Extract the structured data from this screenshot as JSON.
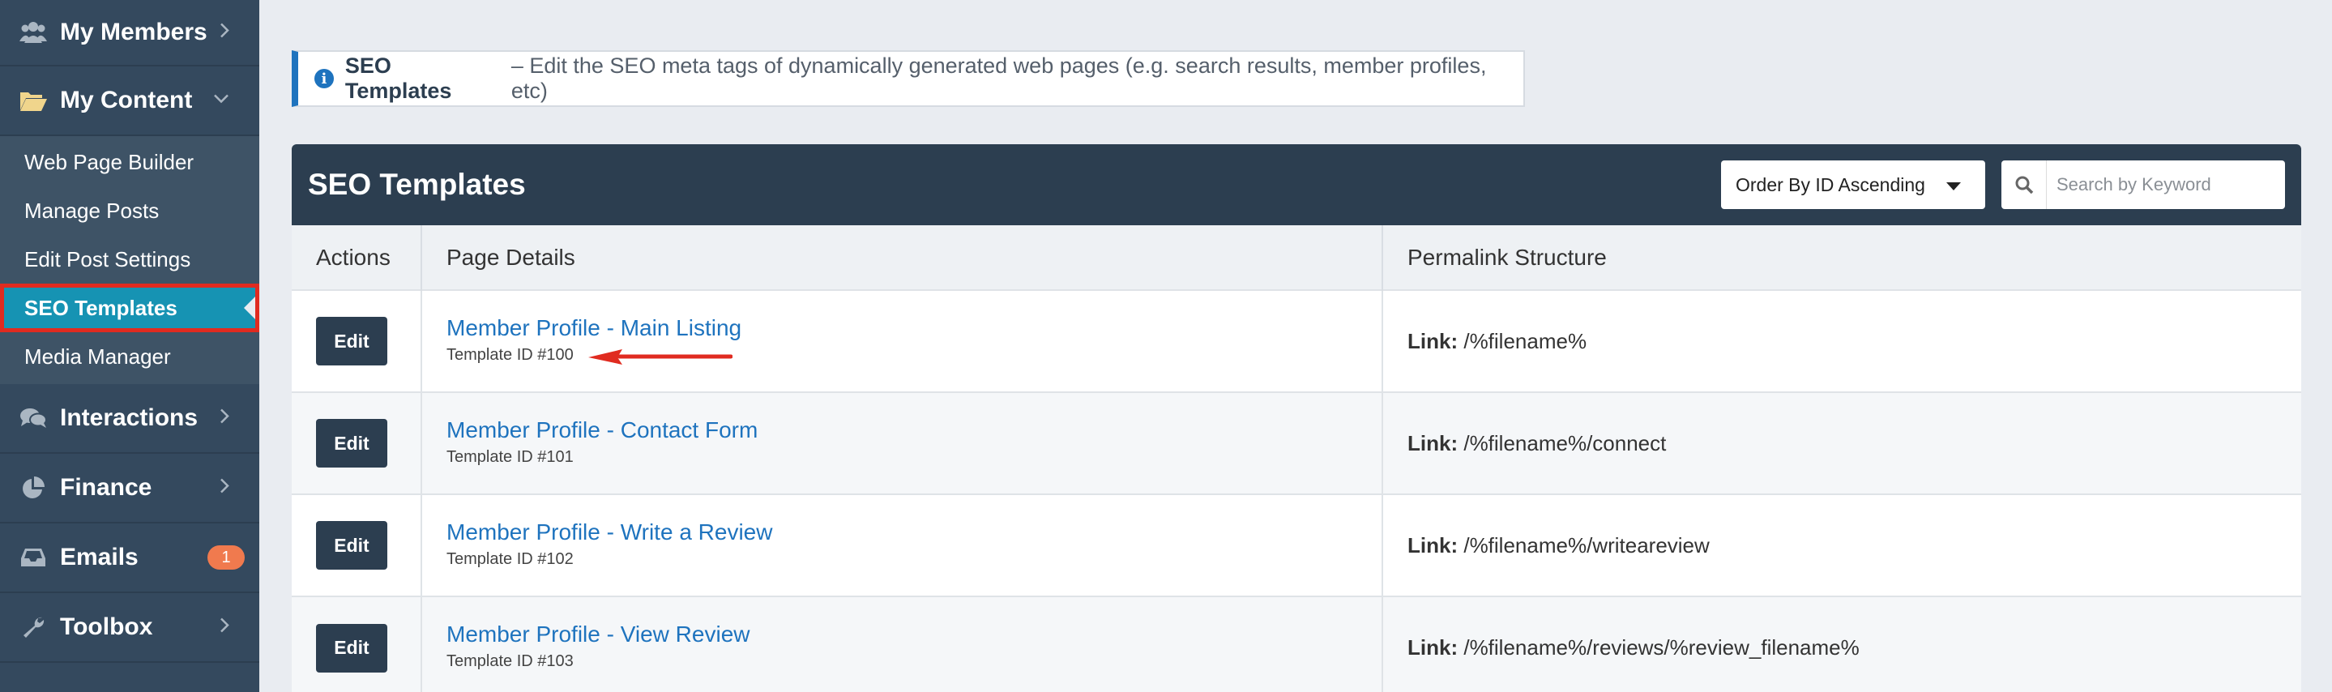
{
  "sidebar": {
    "sections": [
      {
        "label": "My Members",
        "icon": "users-icon"
      },
      {
        "label": "My Content",
        "icon": "folder-open-icon",
        "expanded": true
      },
      {
        "label": "Interactions",
        "icon": "comments-icon"
      },
      {
        "label": "Finance",
        "icon": "pie-chart-icon"
      },
      {
        "label": "Emails",
        "icon": "inbox-icon",
        "badge": "1"
      },
      {
        "label": "Toolbox",
        "icon": "wrench-icon"
      }
    ],
    "submenu": [
      {
        "label": "Web Page Builder"
      },
      {
        "label": "Manage Posts"
      },
      {
        "label": "Edit Post Settings"
      },
      {
        "label": "SEO Templates",
        "active": true
      },
      {
        "label": "Media Manager"
      }
    ]
  },
  "info": {
    "title": "SEO Templates",
    "text": "– Edit the SEO meta tags of dynamically generated web pages (e.g. search results, member profiles, etc)"
  },
  "panel": {
    "title": "SEO Templates",
    "order_select": "Order By ID Ascending",
    "search_placeholder": "Search by Keyword",
    "columns": [
      "Actions",
      "Page Details",
      "Permalink Structure"
    ],
    "edit_label": "Edit",
    "link_label": "Link:",
    "rows": [
      {
        "name": "Member Profile - Main Listing",
        "template_id": "Template ID #100",
        "link": "/%filename%"
      },
      {
        "name": "Member Profile - Contact Form",
        "template_id": "Template ID #101",
        "link": "/%filename%/connect"
      },
      {
        "name": "Member Profile - Write a Review",
        "template_id": "Template ID #102",
        "link": "/%filename%/writeareview"
      },
      {
        "name": "Member Profile - View Review",
        "template_id": "Template ID #103",
        "link": "/%filename%/reviews/%review_filename%"
      }
    ]
  },
  "colors": {
    "sidebar_bg": "#34495e",
    "active_item": "#1693b3",
    "highlight": "#e02b20",
    "header_bg": "#2c3e50",
    "link": "#1e73be",
    "badge": "#f07a4e"
  }
}
